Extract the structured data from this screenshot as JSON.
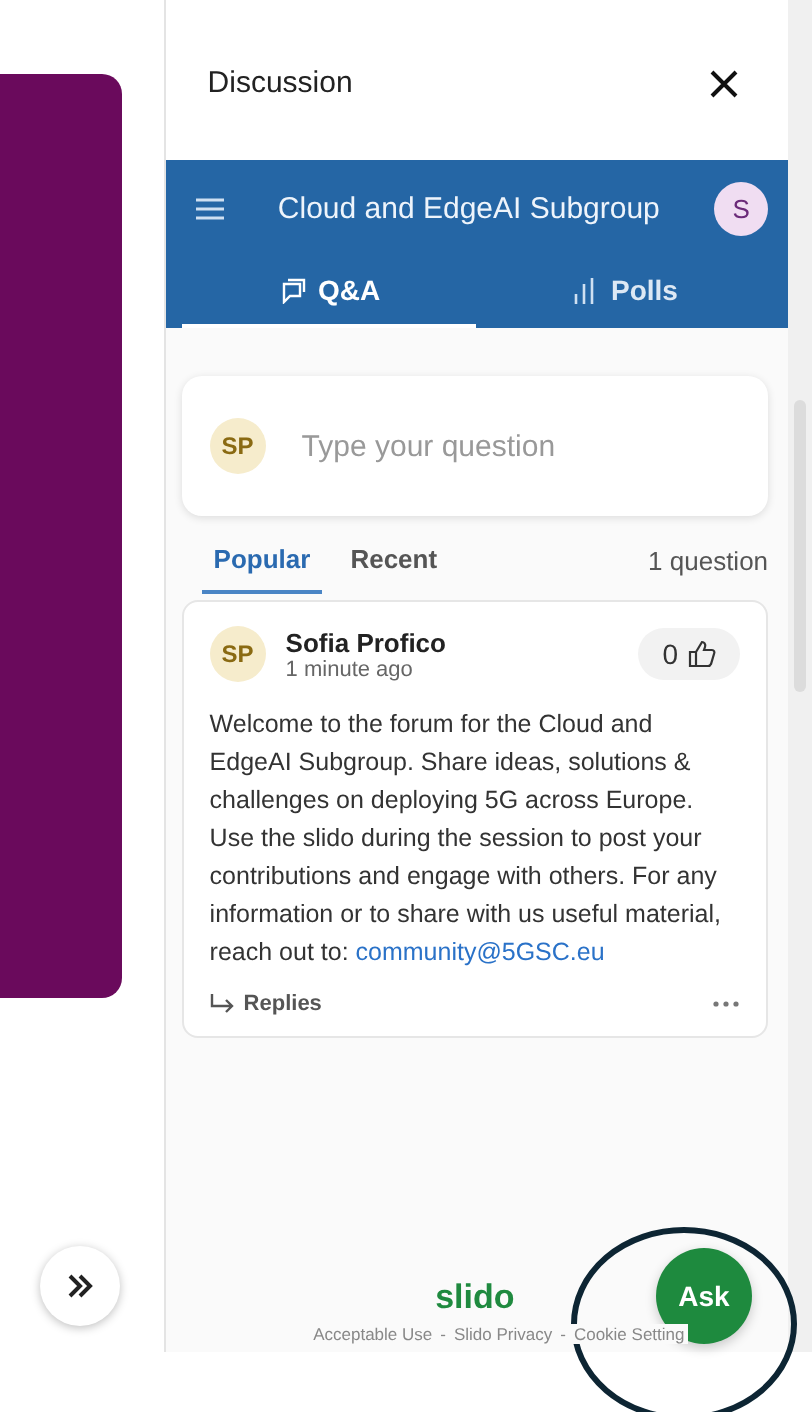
{
  "panel": {
    "title": "Discussion"
  },
  "header": {
    "event_title": "Cloud and EdgeAI Subgroup",
    "user_initial": "S"
  },
  "tabs": [
    {
      "label": "Q&A",
      "selected": true
    },
    {
      "label": "Polls",
      "selected": false
    }
  ],
  "composer": {
    "avatar": "SP",
    "placeholder": "Type your question"
  },
  "sort_tabs": [
    {
      "label": "Popular",
      "selected": true
    },
    {
      "label": "Recent",
      "selected": false
    }
  ],
  "question_count": "1 question",
  "questions": [
    {
      "avatar": "SP",
      "author": "Sofia Profico",
      "time": "1 minute ago",
      "likes": "0",
      "text": "Welcome to the forum for the Cloud and EdgeAI Subgroup. Share ideas, solutions & challenges on deploying 5G across Europe. Use the slido during the session to post your contributions and engage with others. For any information or to share with us useful material, reach out to:",
      "link": "community@5GSC.eu",
      "replies": "Replies"
    }
  ],
  "footer": {
    "brand": "slido",
    "separator": "-",
    "links": [
      "Acceptable Use",
      "Slido Privacy",
      "Cookie Setting"
    ]
  },
  "ask_button": "Ask"
}
